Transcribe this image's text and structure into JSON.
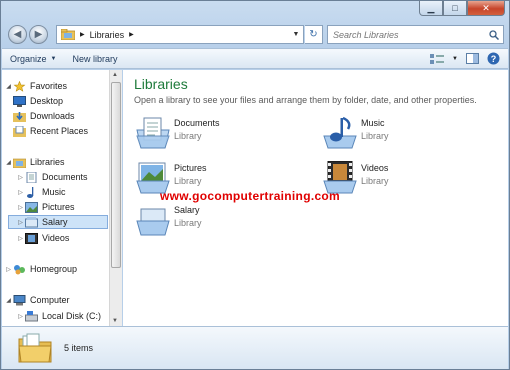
{
  "address": {
    "path": "Libraries"
  },
  "search": {
    "placeholder": "Search Libraries"
  },
  "toolbar": {
    "organize": "Organize",
    "new_library": "New library"
  },
  "nav": {
    "favorites": "Favorites",
    "favorites_items": [
      "Desktop",
      "Downloads",
      "Recent Places"
    ],
    "libraries": "Libraries",
    "libraries_items": [
      "Documents",
      "Music",
      "Pictures",
      "Salary",
      "Videos"
    ],
    "homegroup": "Homegroup",
    "computer": "Computer",
    "computer_items": [
      "Local Disk (C:)"
    ]
  },
  "content": {
    "title": "Libraries",
    "subtitle": "Open a library to see your files and arrange them by folder, date, and other properties.",
    "libraries": [
      {
        "name": "Documents",
        "type": "Library"
      },
      {
        "name": "Music",
        "type": "Library"
      },
      {
        "name": "Pictures",
        "type": "Library"
      },
      {
        "name": "Videos",
        "type": "Library"
      },
      {
        "name": "Salary",
        "type": "Library"
      }
    ],
    "watermark": "www.gocomputertraining.com"
  },
  "details": {
    "count": "5 items"
  },
  "colors": {
    "title_green": "#1e7b3b",
    "watermark_red": "#e00000",
    "selection": "#cde3f8"
  }
}
